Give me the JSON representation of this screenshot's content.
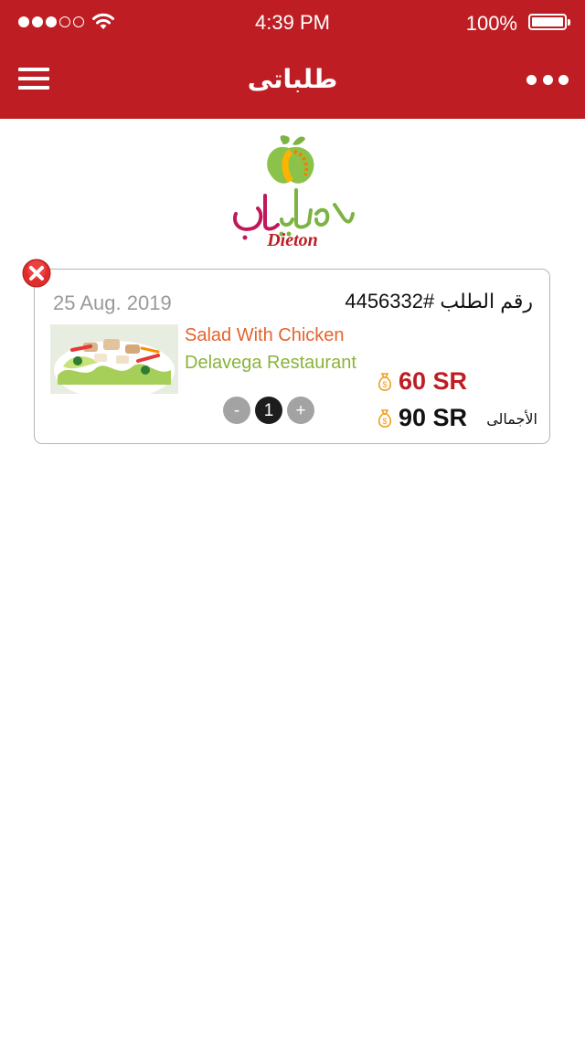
{
  "status_bar": {
    "time": "4:39 PM",
    "battery": "100%",
    "signal_bars": 5,
    "signal_filled": 3
  },
  "header": {
    "title": "طلباتى",
    "background": "#be1e23",
    "menu_icon": "hamburger-menu-icon",
    "more_icon": "more-dots-icon"
  },
  "logo": {
    "text_latin": "Dieton",
    "text_arabic": "دايتون"
  },
  "order": {
    "date": "25 Aug. 2019",
    "order_number_label": "رقم الطلب #4456332",
    "item_name": "Salad With Chicken",
    "restaurant": "Delavega Restaurant",
    "quantity": "1",
    "minus_label": "-",
    "plus_label": "+",
    "price": "60 SR",
    "total_price": "90 SR",
    "total_label": "الأجمالى",
    "delete_icon": "delete-x-icon",
    "money_icon": "money-bag-icon"
  },
  "colors": {
    "brand_red": "#be1e23",
    "item_orange": "#e4632e",
    "restaurant_green": "#8ab33a",
    "money_icon_orange": "#f0a020"
  }
}
